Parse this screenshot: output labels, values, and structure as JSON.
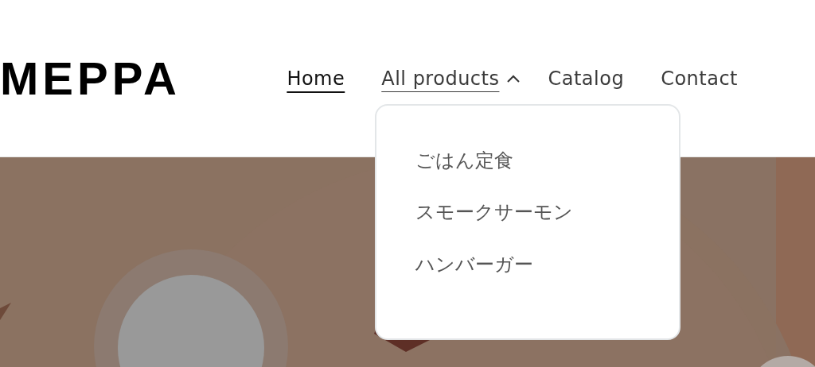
{
  "logo": "MEPPA",
  "nav": [
    {
      "label": "Home",
      "selected": true,
      "expanded": false,
      "kind": "link"
    },
    {
      "label": "All products",
      "selected": false,
      "expanded": true,
      "kind": "dropdown"
    },
    {
      "label": "Catalog",
      "selected": false,
      "expanded": false,
      "kind": "link"
    },
    {
      "label": "Contact",
      "selected": false,
      "expanded": false,
      "kind": "link"
    }
  ],
  "dropdown": {
    "items": [
      "ごはん定食",
      "スモークサーモン",
      "ハンバーガー"
    ]
  }
}
